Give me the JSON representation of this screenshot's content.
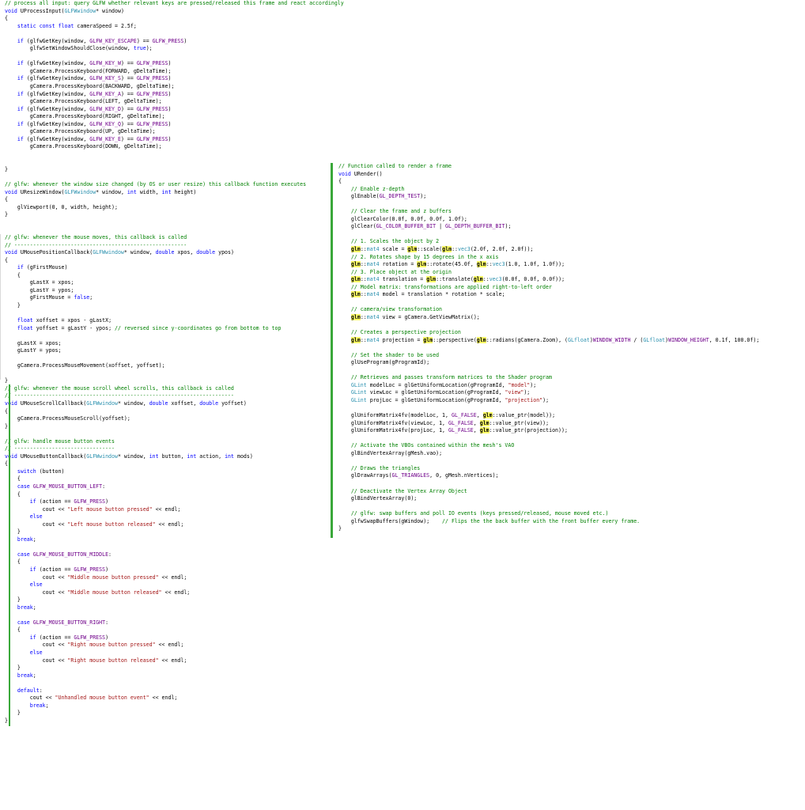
{
  "left_panel": {
    "lines": [
      "// process all input: query GLFW whether relevant keys are pressed/released this frame and react accordingly",
      "void UProcessInput(GLFWwindow* window)",
      "{",
      "    static const float cameraSpeed = 2.5f;",
      "",
      "    if (glfwGetKey(window, GLFW_KEY_ESCAPE) == GLFW_PRESS)",
      "        glfwSetWindowShouldClose(window, true);",
      "",
      "    if (glfwGetKey(window, GLFW_KEY_W) == GLFW_PRESS)",
      "        gCamera.ProcessKeyboard(FORWARD, gDeltaTime);",
      "    if (glfwGetKey(window, GLFW_KEY_S) == GLFW_PRESS)",
      "        gCamera.ProcessKeyboard(BACKWARD, gDeltaTime);",
      "    if (glfwGetKey(window, GLFW_KEY_A) == GLFW_PRESS)",
      "        gCamera.ProcessKeyboard(LEFT, gDeltaTime);",
      "    if (glfwGetKey(window, GLFW_KEY_D) == GLFW_PRESS)",
      "        gCamera.ProcessKeyboard(RIGHT, gDeltaTime);",
      "    if (glfwGetKey(window, GLFW_KEY_Q) == GLFW_PRESS)",
      "        gCamera.ProcessKeyboard(UP, gDeltaTime);",
      "    if (glfwGetKey(window, GLFW_KEY_E) == GLFW_PRESS)",
      "        gCamera.ProcessKeyboard(DOWN, gDeltaTime);",
      "",
      "",
      "}",
      "",
      "// glfw: whenever the window size changed (by OS or user resize) this callback function executes",
      "void UResizeWindow(GLFWwindow* window, int width, int height)",
      "{",
      "    glViewport(0, 0, width, height);",
      "}",
      "",
      "",
      "// glfw: whenever the mouse moves, this callback is called",
      "// -------------------------------------------------------",
      "void UMousePositionCallback(GLFWwindow* window, double xpos, double ypos)",
      "{",
      "    if (gFirstMouse)",
      "    {",
      "        gLastX = xpos;",
      "        gLastY = ypos;",
      "        gFirstMouse = false;",
      "    }",
      "",
      "    float xoffset = xpos - gLastX;",
      "    float yoffset = gLastY - ypos; // reversed since y-coordinates go from bottom to top",
      "",
      "    gLastX = xpos;",
      "    gLastY = ypos;",
      "",
      "    gCamera.ProcessMouseMovement(xoffset, yoffset);",
      "",
      "}",
      "// glfw: whenever the mouse scroll wheel scrolls, this callback is called",
      "// ----------------------------------------------------------------------",
      "void UMouseScrollCallback(GLFWwindow* window, double xoffset, double yoffset)",
      "{",
      "    gCamera.ProcessMouseScroll(yoffset);",
      "}",
      "",
      "// glfw: handle mouse button events",
      "// --------------------------------",
      "void UMouseButtonCallback(GLFWwindow* window, int button, int action, int mods)",
      "{",
      "    switch (button)",
      "    {",
      "    case GLFW_MOUSE_BUTTON_LEFT:",
      "    {",
      "        if (action == GLFW_PRESS)",
      "            cout << \"Left mouse button pressed\" << endl;",
      "        else",
      "            cout << \"Left mouse button released\" << endl;",
      "    }",
      "    break;",
      "",
      "    case GLFW_MOUSE_BUTTON_MIDDLE:",
      "    {",
      "        if (action == GLFW_PRESS)",
      "            cout << \"Middle mouse button pressed\" << endl;",
      "        else",
      "            cout << \"Middle mouse button released\" << endl;",
      "    }",
      "    break;",
      "",
      "    case GLFW_MOUSE_BUTTON_RIGHT:",
      "    {",
      "        if (action == GLFW_PRESS)",
      "            cout << \"Right mouse button pressed\" << endl;",
      "        else",
      "            cout << \"Right mouse button released\" << endl;",
      "    }",
      "    break;",
      "",
      "    default:",
      "        cout << \"Unhandled mouse button event\" << endl;",
      "        break;",
      "    }",
      "}"
    ]
  },
  "right_panel": {
    "lines": [
      "// Function called to render a frame",
      "void URender()",
      "{",
      "    // Enable z-depth",
      "    glEnable(GL_DEPTH_TEST);",
      "",
      "    // Clear the frame and z buffers",
      "    glClearColor(0.0f, 0.0f, 0.0f, 1.0f);",
      "    glClear(GL_COLOR_BUFFER_BIT | GL_DEPTH_BUFFER_BIT);",
      "",
      "    // 1. Scales the object by 2",
      "    glm::mat4 scale = glm::scale(glm::vec3(2.0f, 2.0f, 2.0f));",
      "    // 2. Rotates shape by 15 degrees in the x axis",
      "    glm::mat4 rotation = glm::rotate(45.0f, glm::vec3(1.0, 1.0f, 1.0f));",
      "    // 3. Place object at the origin",
      "    glm::mat4 translation = glm::translate(glm::vec3(0.0f, 0.0f, 0.0f));",
      "    // Model matrix: transformations are applied right-to-left order",
      "    glm::mat4 model = translation * rotation * scale;",
      "",
      "    // camera/view transformation",
      "    glm::mat4 view = gCamera.GetViewMatrix();",
      "",
      "    // Creates a perspective projection",
      "    glm::mat4 projection = glm::perspective(glm::radians(gCamera.Zoom), (GLfloat)WINDOW_WIDTH / (GLfloat)WINDOW_HEIGHT, 0.1f, 100.0f);",
      "",
      "    // Set the shader to be used",
      "    glUseProgram(gProgramId);",
      "",
      "    // Retrieves and passes transform matrices to the Shader program",
      "    GLint modelLoc = glGetUniformLocation(gProgramId, \"model\");",
      "    GLint viewLoc = glGetUniformLocation(gProgramId, \"view\");",
      "    GLint projLoc = glGetUniformLocation(gProgramId, \"projection\");",
      "",
      "    glUniformMatrix4fv(modelLoc, 1, GL_FALSE, glm::value_ptr(model));",
      "    glUniformMatrix4fv(viewLoc, 1, GL_FALSE, glm::value_ptr(view));",
      "    glUniformMatrix4fv(projLoc, 1, GL_FALSE, glm::value_ptr(projection));",
      "",
      "    // Activate the VBOs contained within the mesh's VAO",
      "    glBindVertexArray(gMesh.vao);",
      "",
      "    // Draws the triangles",
      "    glDrawArrays(GL_TRIANGLES, 0, gMesh.nVertices);",
      "",
      "    // Deactivate the Vertex Array Object",
      "    glBindVertexArray(0);",
      "",
      "    // glfw: swap buffers and poll IO events (keys pressed/released, mouse moved etc.)",
      "    glfwSwapBuffers(gWindow);    // Flips the the back buffer with the front buffer every frame.",
      "}"
    ]
  },
  "colors": {
    "comment": "#008000",
    "keyword": "#0000ff",
    "type": "#2b91af",
    "string": "#a31515",
    "macro": "#6f008a",
    "change_bar": "#3aa83a"
  }
}
